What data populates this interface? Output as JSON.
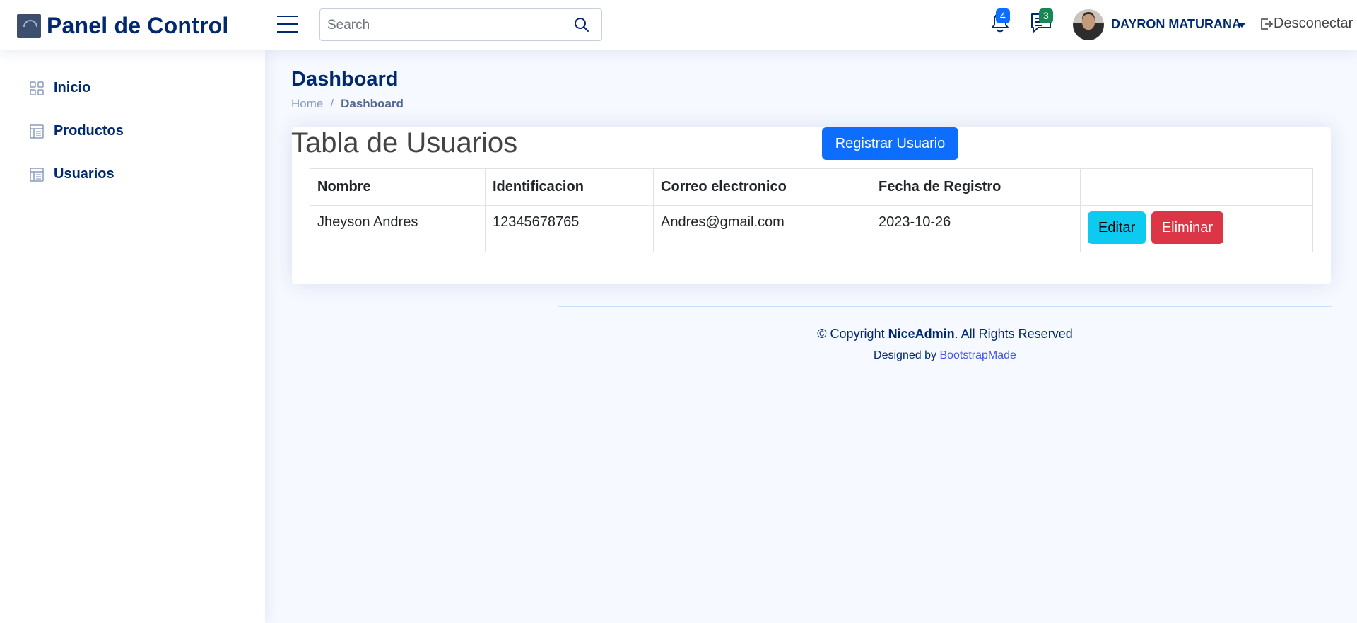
{
  "header": {
    "brand": "Panel de Control",
    "search_placeholder": "Search",
    "notifications_count": "4",
    "messages_count": "3",
    "user_name": "DAYRON MATURANA",
    "logout_label": "Desconectar",
    "colors": {
      "brand": "#012970",
      "notif_badge": "#0d6efd",
      "msg_badge": "#198754"
    }
  },
  "sidebar": {
    "items": [
      {
        "label": "Inicio",
        "icon": "grid-icon"
      },
      {
        "label": "Productos",
        "icon": "layout-text-icon"
      },
      {
        "label": "Usuarios",
        "icon": "layout-text-icon"
      }
    ]
  },
  "page": {
    "title": "Dashboard",
    "breadcrumb": {
      "home": "Home",
      "separator": "/",
      "current": "Dashboard"
    }
  },
  "card": {
    "title": "Tabla de Usuarios",
    "register_button": "Registrar Usuario",
    "table": {
      "headers": [
        "Nombre",
        "Identificacion",
        "Correo electronico",
        "Fecha de Registro",
        ""
      ],
      "rows": [
        {
          "name": "Jheyson Andres",
          "id": "12345678765",
          "email": "Andres@gmail.com",
          "date": "2023-10-26",
          "edit": "Editar",
          "delete": "Eliminar"
        }
      ]
    }
  },
  "footer": {
    "copyright_prefix": "© Copyright",
    "brand": "NiceAdmin",
    "copyright_suffix": ". All Rights Reserved",
    "designed_by": "Designed by",
    "designer": "BootstrapMade"
  }
}
